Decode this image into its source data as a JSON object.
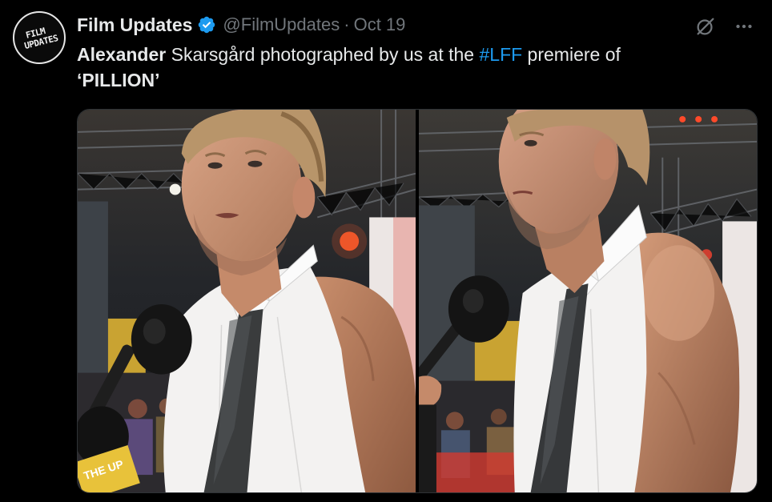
{
  "author": {
    "avatar_line1": "FILM",
    "avatar_line2": "UPDATES",
    "display_name": "Film Updates",
    "handle": "@FilmUpdates",
    "separator": "·",
    "date": "Oct 19",
    "verified_color": "#1d9bf0"
  },
  "tweet": {
    "text_bold": "Alexander",
    "text_part1": " Skarsgård photographed by us at the ",
    "hashtag": "#LFF",
    "text_part2": " premiere of ",
    "text_title": "‘PILLION’"
  },
  "media": {
    "count": 2,
    "mic_label": "THE UP"
  },
  "icons": {
    "grok": "grok-icon",
    "more": "more-icon",
    "verified": "verified-badge-icon"
  },
  "colors": {
    "background": "#000000",
    "text": "#e7e9ea",
    "muted": "#71767b",
    "link": "#1d9bf0"
  }
}
